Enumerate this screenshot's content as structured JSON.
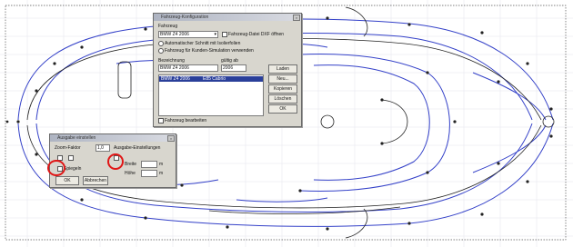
{
  "window": {
    "title": "Fahrzeug-Konfiguration",
    "vehicle_label": "Fahrzeug",
    "vehicle_value": "BMW Z4 2006",
    "option_check": "Fahrzeug-Datei DXF öffnen",
    "radio_1": "Automatischer Schnitt mit Isolierfolien",
    "radio_2": "Fahrzeug für Kunden-Simulation verwenden",
    "name_label": "Bezeichnung",
    "name_value": "BMW Z4 2006",
    "scale_label": "gültig ab",
    "scale_value": "2006",
    "list_items": [
      "BMW Z4 2006",
      "E85 Cabrio"
    ],
    "buttons": [
      "Laden",
      "Neu...",
      "Kopieren",
      "Löschen",
      "OK"
    ],
    "bottom_check": "Fahrzeug bearbeiten"
  },
  "sub_dialog": {
    "title": "Ausgabe einstellen",
    "field_label": "Zoom-Faktor",
    "field_value": "1,0",
    "right_label": "Ausgabe-Einstellungen",
    "row1": "Breite",
    "row2": "Höhe",
    "unit": "m",
    "check_label": "Spiegeln",
    "ok": "OK",
    "cancel": "Abbrechen"
  }
}
